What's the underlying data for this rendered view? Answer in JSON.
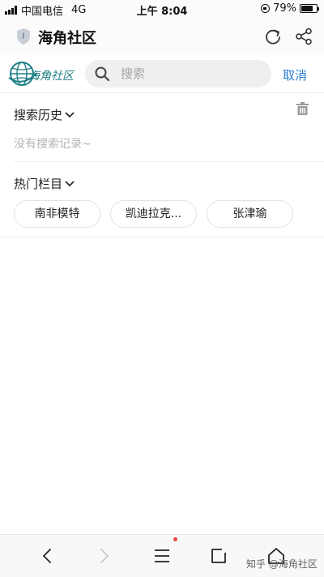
{
  "status_bar": {
    "carrier": "中国电信",
    "network": "4G",
    "time": "上午 8:04",
    "battery": "79%",
    "battery_level": 0.79
  },
  "title_bar": {
    "title": "海角社区",
    "icons": [
      "shield-icon",
      "refresh-icon",
      "share-icon"
    ]
  },
  "search": {
    "logo_text": "海角社区",
    "placeholder": "搜索",
    "value": "",
    "cancel_label": "取消"
  },
  "history": {
    "title": "搜索历史",
    "empty_text": "没有搜索记录~"
  },
  "hot": {
    "title": "热门栏目",
    "tags": [
      "南非模特",
      "凯迪拉克...",
      "张津瑜"
    ]
  },
  "bottom_nav": {
    "items": [
      "back-icon",
      "forward-icon",
      "menu-icon",
      "tabs-icon",
      "home-icon"
    ],
    "watermark": "知乎 @海角社区",
    "accent": "#e5463d"
  },
  "colors": {
    "link": "#2a7fd0",
    "logo": "#1f7f86",
    "muted_text": "#b3b3b3"
  }
}
